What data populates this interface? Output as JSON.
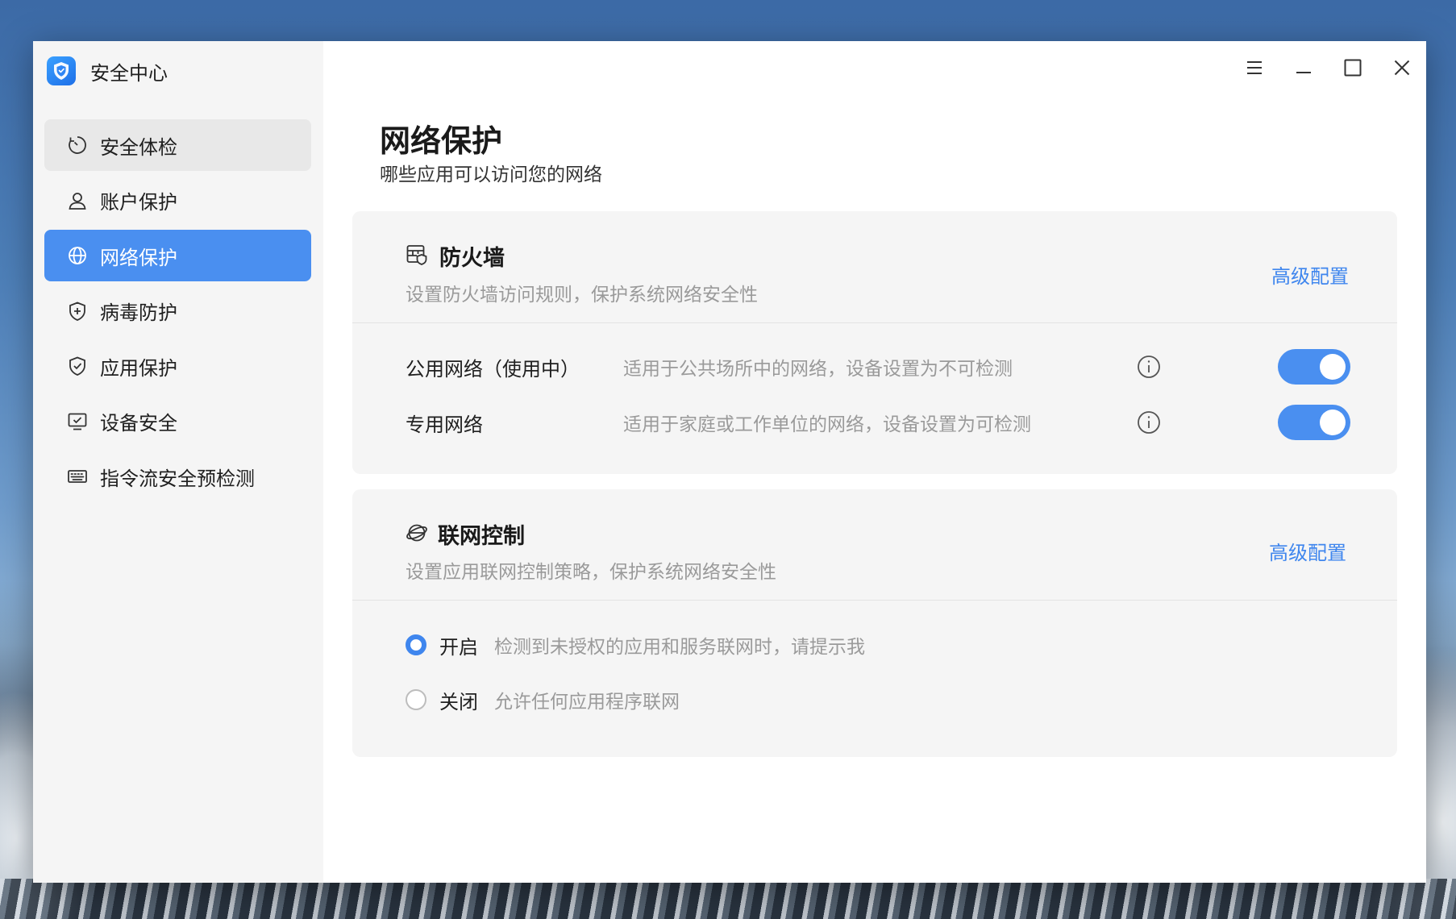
{
  "app": {
    "title": "安全中心",
    "logo_icon": "shield-logo-icon"
  },
  "sidebar": {
    "items": [
      {
        "label": "安全体检",
        "icon": "scan-icon",
        "state": "hover"
      },
      {
        "label": "账户保护",
        "icon": "user-icon",
        "state": "normal"
      },
      {
        "label": "网络保护",
        "icon": "globe-icon",
        "state": "active"
      },
      {
        "label": "病毒防护",
        "icon": "shield-plus-icon",
        "state": "normal"
      },
      {
        "label": "应用保护",
        "icon": "shield-check-icon",
        "state": "normal"
      },
      {
        "label": "设备安全",
        "icon": "monitor-check-icon",
        "state": "normal"
      },
      {
        "label": "指令流安全预检测",
        "icon": "keyboard-icon",
        "state": "normal"
      }
    ]
  },
  "window_controls": [
    "menu-icon",
    "minimize-icon",
    "maximize-icon",
    "close-icon"
  ],
  "page": {
    "title": "网络保护",
    "subtitle": "哪些应用可以访问您的网络"
  },
  "firewall": {
    "title": "防火墙",
    "desc": "设置防火墙访问规则，保护系统网络安全性",
    "link": "高级配置",
    "rows": [
      {
        "name": "公用网络（使用中）",
        "desc": "适用于公共场所中的网络，设备设置为不可检测",
        "enabled": true
      },
      {
        "name": "专用网络",
        "desc": "适用于家庭或工作单位的网络，设备设置为可检测",
        "enabled": true
      }
    ]
  },
  "network_control": {
    "title": "联网控制",
    "desc": "设置应用联网控制策略，保护系统网络安全性",
    "link": "高级配置",
    "options": [
      {
        "label": "开启",
        "desc": "检测到未授权的应用和服务联网时，请提示我",
        "checked": true
      },
      {
        "label": "关闭",
        "desc": "允许任何应用程序联网",
        "checked": false
      }
    ]
  },
  "colors": {
    "accent": "#4a8ff0",
    "link": "#3f86ee"
  }
}
